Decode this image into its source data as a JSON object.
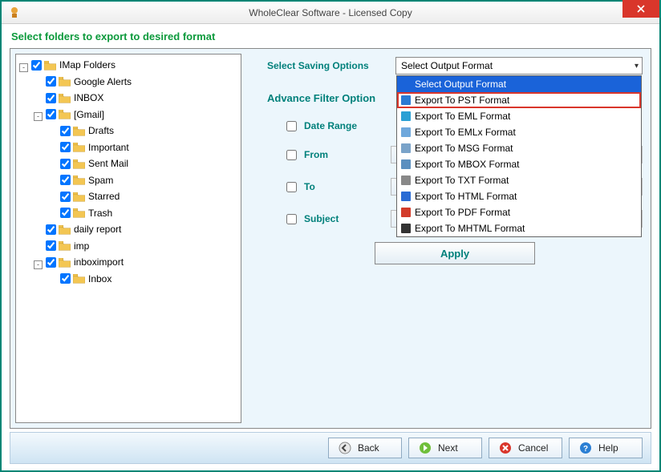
{
  "window": {
    "title": "WholeClear Software - Licensed Copy"
  },
  "instruction": "Select folders to export to desired format",
  "tree": [
    {
      "label": "IMap Folders",
      "level": 0,
      "exp": "-",
      "checked": true,
      "hasChildren": true
    },
    {
      "label": "Google Alerts",
      "level": 1,
      "checked": true
    },
    {
      "label": "INBOX",
      "level": 1,
      "checked": true
    },
    {
      "label": "[Gmail]",
      "level": 1,
      "exp": "-",
      "checked": true,
      "hasChildren": true
    },
    {
      "label": "Drafts",
      "level": 2,
      "checked": true
    },
    {
      "label": "Important",
      "level": 2,
      "checked": true
    },
    {
      "label": "Sent Mail",
      "level": 2,
      "checked": true
    },
    {
      "label": "Spam",
      "level": 2,
      "checked": true
    },
    {
      "label": "Starred",
      "level": 2,
      "checked": true
    },
    {
      "label": "Trash",
      "level": 2,
      "checked": true
    },
    {
      "label": "daily report",
      "level": 1,
      "checked": true
    },
    {
      "label": "imp",
      "level": 1,
      "checked": true
    },
    {
      "label": "inboximport",
      "level": 1,
      "exp": "-",
      "checked": true,
      "hasChildren": true
    },
    {
      "label": "Inbox",
      "level": 2,
      "checked": true
    }
  ],
  "saving": {
    "label": "Select Saving Options",
    "selected": "Select Output Format",
    "options": [
      {
        "label": "Select Output Format",
        "iconColor": null,
        "selected": true
      },
      {
        "label": "Export To PST Format",
        "iconColor": "#2a7ad4",
        "highlighted": true
      },
      {
        "label": "Export To EML Format",
        "iconColor": "#2aa0d4"
      },
      {
        "label": "Export To EMLx Format",
        "iconColor": "#6fa8dc"
      },
      {
        "label": "Export To MSG Format",
        "iconColor": "#7aa3c9"
      },
      {
        "label": "Export To MBOX Format",
        "iconColor": "#5b8fbf"
      },
      {
        "label": "Export To TXT Format",
        "iconColor": "#888888"
      },
      {
        "label": "Export To HTML Format",
        "iconColor": "#2a6bd4"
      },
      {
        "label": "Export To PDF Format",
        "iconColor": "#d23b2a"
      },
      {
        "label": "Export To MHTML Format",
        "iconColor": "#333333"
      }
    ]
  },
  "advanceFilter": {
    "title": "Advance Filter Option",
    "filters": {
      "dateRange": "Date Range",
      "from": "From",
      "to": "To",
      "subject": "Subject"
    },
    "apply": "Apply"
  },
  "footer": {
    "back": "Back",
    "next": "Next",
    "cancel": "Cancel",
    "help": "Help"
  }
}
